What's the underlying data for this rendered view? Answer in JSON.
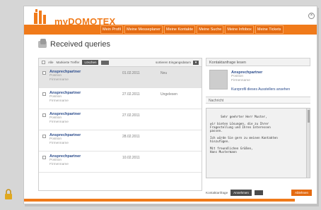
{
  "header": {
    "logo_text": "myDOMOTEX",
    "nav": [
      "Mein Profil",
      "Meine Messeplaner",
      "Meine Kontakte",
      "Meine Suche",
      "Meine Infobox",
      "Meine Tickets"
    ]
  },
  "page": {
    "title": "Received queries"
  },
  "toolbar": {
    "all_label": "Alle",
    "filter_label": "Markierte Treffer",
    "filter_button": "Löschen",
    "sort_label": "sortieren Eingangsdatum",
    "sort_value": "▾"
  },
  "rows": [
    {
      "name": "Ansprechpartner",
      "position": "Position",
      "company": "Firmenname",
      "date": "01.02.2011",
      "status": "Neu"
    },
    {
      "name": "Ansprechpartner",
      "position": "Position",
      "company": "Firmenname",
      "date": "27.02.2011",
      "status": "Ungelesen"
    },
    {
      "name": "Ansprechpartner",
      "position": "Position",
      "company": "Firmenname",
      "date": "27.02.2011",
      "status": ""
    },
    {
      "name": "Ansprechpartner",
      "position": "Position",
      "company": "Firmenname",
      "date": "28.02.2011",
      "status": ""
    },
    {
      "name": "Ansprechpartner",
      "position": "Position",
      "company": "Firmenname",
      "date": "10.02.2011",
      "status": ""
    }
  ],
  "detail": {
    "header": "Kontaktanfrage lesen",
    "contact": {
      "name": "Ansprechpartner",
      "position": "Position",
      "company": "Firmenname"
    },
    "profile_link": "Kurzprofil dieses Ausstellers ansehen",
    "message_label": "Nachricht",
    "message": "Sehr geehrter Herr Muster,\n\nwir bieten Lösungen, die zu Ihrer\nFragestellung und Ihren Interessen\npassen.\n\nIch würde Sie gern zu meinen Kontakten\nhinzufügen.\n\nMit freundlichen Grüßen,\nHans Mustermann"
  },
  "footer": {
    "label": "Kontaktanfrage",
    "button1": "Annehmen",
    "button2": "Ablehnen"
  }
}
